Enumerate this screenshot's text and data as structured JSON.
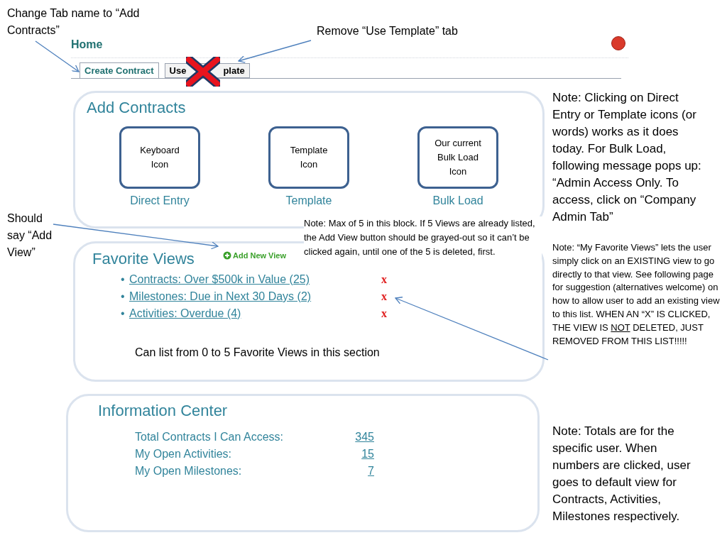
{
  "annotations": [
    {
      "kind": "callout",
      "lines": [
        "Change Tab name to “Add",
        "Contracts”"
      ]
    },
    {
      "kind": "callout",
      "lines": [
        "Remove “Use Template” tab"
      ]
    },
    {
      "kind": "callout",
      "lines": [
        "Should",
        "say “Add",
        "View”"
      ]
    }
  ],
  "header": {
    "title": "Home"
  },
  "tabs": [
    {
      "parts": [
        "Create Contract"
      ],
      "selected": true,
      "removed": false
    },
    {
      "parts": [
        "Use",
        "plate"
      ],
      "selected": false,
      "removed": true
    }
  ],
  "add_contracts": {
    "title": "Add Contracts",
    "tiles": [
      {
        "icon_text": "Keyboard Icon",
        "label": "Direct Entry"
      },
      {
        "icon_text": "Template Icon",
        "label": "Template"
      },
      {
        "icon_text": "Our current Bulk Load Icon",
        "label": "Bulk Load"
      }
    ]
  },
  "favorite_views": {
    "title": "Favorite Views",
    "add_button": "Add New View",
    "note": "Note: Max of 5 in this block.  If 5 Views are already listed, the Add View button should be grayed-out so it can’t be clicked again, until one of the 5 is deleted, first.",
    "items": [
      {
        "bullet": "•",
        "label": "Contracts:  Over $500k in Value (25)",
        "remove": "x"
      },
      {
        "bullet": "•",
        "label": "Milestones: Due in Next 30 Days (2)",
        "remove": "x"
      },
      {
        "bullet": "•",
        "label": "Activities: Overdue (4)",
        "remove": "x"
      }
    ],
    "footer": "Can list from 0 to 5 Favorite Views in this section"
  },
  "information_center": {
    "title": "Information Center",
    "rows": [
      {
        "label": "Total Contracts I Can Access:",
        "value": "345"
      },
      {
        "label": "My Open Activities:",
        "value": "15"
      },
      {
        "label": "My Open Milestones:",
        "value": "7"
      }
    ]
  },
  "side_notes": [
    {
      "segments": [
        {
          "text": "Note: Clicking on Direct Entry or Template icons (or words) works as it does today.  For Bulk Load, following message pops up: “Admin Access Only. To access, click on “Company Admin Tab”",
          "underline": false
        }
      ]
    },
    {
      "segments": [
        {
          "text": "Note: “My Favorite Views” lets the user simply click on an EXISTING view to go directly to that view.  See following page for suggestion (alternatives welcome) on how to allow user to add an existing view to this list. WHEN AN “X” IS CLICKED, THE VIEW IS ",
          "underline": false
        },
        {
          "text": "NOT",
          "underline": true
        },
        {
          "text": " DELETED, JUST REMOVED FROM THIS LIST!!!!!",
          "underline": false
        }
      ]
    },
    {
      "segments": [
        {
          "text": "Note: Totals are for the specific user.  When numbers are clicked, user goes to default view for Contracts, Activities, Milestones respectively.",
          "underline": false
        }
      ]
    }
  ]
}
